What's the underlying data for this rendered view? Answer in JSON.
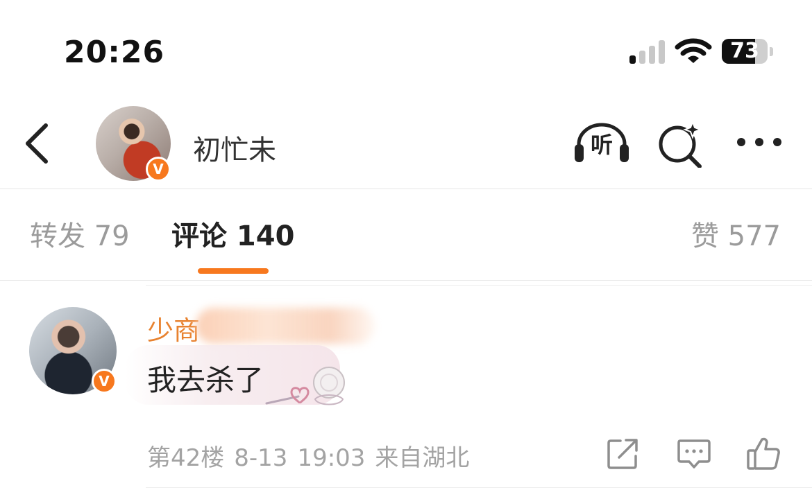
{
  "status_bar": {
    "time": "20:26",
    "battery_level": "73",
    "battery_fraction": 0.73
  },
  "header": {
    "profile_name": "初忙未",
    "verified_label": "V",
    "listen_label": "听"
  },
  "tabs": [
    {
      "label": "转发 79",
      "active": false
    },
    {
      "label": "评论 140",
      "active": true
    },
    {
      "label": "赞 577",
      "active": false
    }
  ],
  "comment": {
    "username_visible": "少商",
    "verified_label": "V",
    "text": "我去杀了",
    "floor": "第42楼",
    "date": "8-13",
    "time": "19:03",
    "location": "来自湖北"
  },
  "icons": {
    "back": "back-chevron-icon",
    "listen": "headphones-icon",
    "search": "sparkle-search-icon",
    "more": "more-dots-icon",
    "share": "share-icon",
    "reply": "comment-icon",
    "like": "thumbs-up-icon"
  },
  "colors": {
    "accent": "#f7781e",
    "username": "#e8822f",
    "muted_text": "#9b9b9b"
  }
}
